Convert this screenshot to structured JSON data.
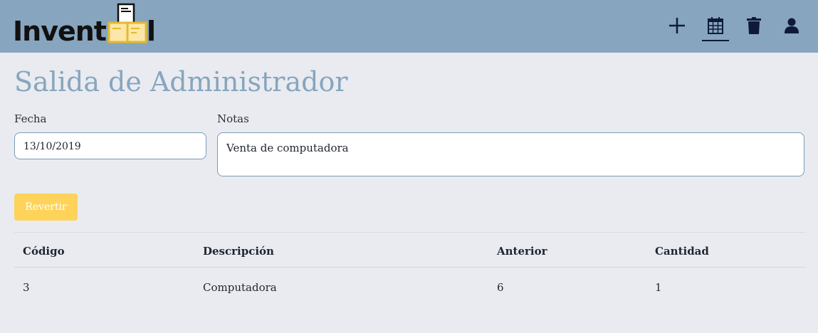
{
  "app": {
    "logo_text": "Invent",
    "logo_suffix": "l"
  },
  "nav": {
    "icons": [
      "plus-icon",
      "calendar-icon",
      "trash-icon",
      "user-icon"
    ],
    "active": "calendar-icon"
  },
  "page": {
    "title": "Salida de Administrador"
  },
  "form": {
    "fecha_label": "Fecha",
    "fecha_value": "13/10/2019",
    "notas_label": "Notas",
    "notas_value": "Venta de computadora",
    "revert_button": "Revertir"
  },
  "table": {
    "headers": [
      "Código",
      "Descripción",
      "Anterior",
      "Cantidad"
    ],
    "rows": [
      {
        "codigo": "3",
        "descripcion": "Computadora",
        "anterior": "6",
        "cantidad": "1"
      }
    ]
  },
  "colors": {
    "navbar": "#87a5be",
    "title": "#87a5be",
    "accent_button": "#fdd35a",
    "background": "#e9ebf0",
    "icon": "#0f1a3a"
  }
}
